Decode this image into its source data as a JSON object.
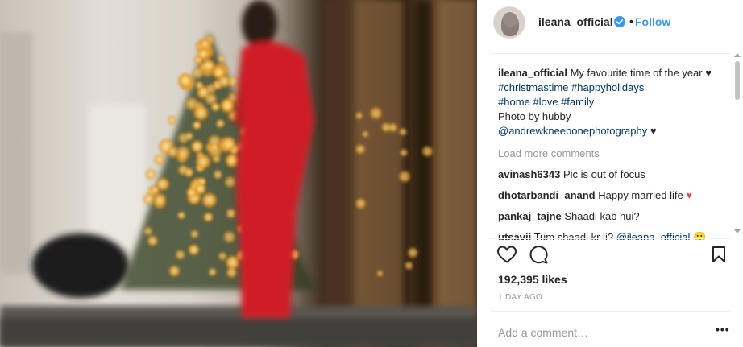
{
  "post": {
    "image_alt": "Photo: woman in red dress beside a lit Christmas tree",
    "account": {
      "username": "ileana_official",
      "verified": true,
      "dot": "•",
      "follow_label": "Follow"
    },
    "caption": {
      "username": "ileana_official",
      "text_1": " My favourite time of the year ",
      "heart_1": "♥",
      "sp_1": " ",
      "tag_1": "#christmastime",
      "sp_2": " ",
      "tag_2": "#happyholidays",
      "tag_3": "#home",
      "sp_3": " ",
      "tag_4": "#love",
      "sp_4": " ",
      "tag_5": "#family",
      "line_photo": "Photo by hubby",
      "mention": "@andrewkneebonephotography",
      "heart_2": " ♥"
    },
    "load_more": "Load more comments",
    "comments": [
      {
        "user": "avinash6343",
        "text": " Pic is out of focus",
        "suffix": ""
      },
      {
        "user": "dhotarbandi_anand",
        "text": " Happy married life ",
        "suffix": "♥"
      },
      {
        "user": "pankaj_tajne",
        "text": " Shaadi kab hui?",
        "suffix": ""
      },
      {
        "user": "utsavii",
        "text": " Tum shaadi kr li? ",
        "mention": "@ileana_official",
        "suffix": " 😗"
      }
    ],
    "likes": "192,395 likes",
    "time": "1 DAY AGO",
    "add_comment_placeholder": "Add a comment…",
    "options": "•••",
    "icons": {
      "like": "heart-outline-icon",
      "comment": "comment-bubble-icon",
      "save": "bookmark-icon",
      "verified": "verified-badge-icon"
    },
    "colors": {
      "link": "#3897f0",
      "hashtag": "#003569",
      "muted": "#999999",
      "dress": "#d01f25"
    }
  }
}
